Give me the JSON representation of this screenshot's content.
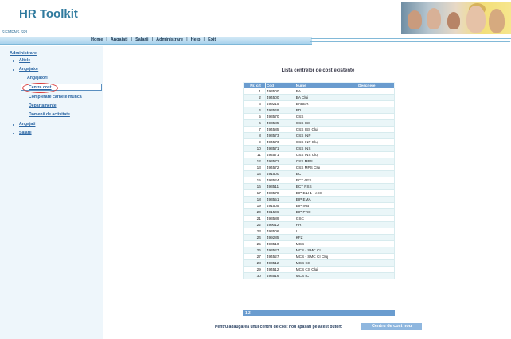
{
  "app": {
    "title": "HR Toolkit",
    "company": "SIEMENS SRL"
  },
  "menu": [
    "Home",
    "Angajati",
    "Salarii",
    "Administrare",
    "Help",
    "Exit"
  ],
  "sidebar": {
    "title": "Administrare",
    "items": [
      {
        "label": "Altele",
        "bullet": true
      },
      {
        "label": "Angajator",
        "bullet": true
      },
      {
        "label": "Angajatori",
        "bullet": false
      },
      {
        "label": "Centre cost",
        "bullet": false,
        "selected": true
      },
      {
        "label": "Completare carnete munca",
        "bullet": false
      },
      {
        "label": "Departamente",
        "bullet": false
      },
      {
        "label": "Domenii de activitate",
        "bullet": false
      },
      {
        "label": "Angajati",
        "bullet": true
      },
      {
        "label": "Salarii",
        "bullet": true
      }
    ]
  },
  "main": {
    "title": "Lista centrelor de cost existente",
    "columns": [
      "Nr. crt",
      "Cod",
      "Nume",
      "Descriere"
    ],
    "rows": [
      [
        "1",
        "493500",
        "BA",
        ""
      ],
      [
        "2",
        "494500",
        "BA Cluj",
        ""
      ],
      [
        "3",
        "499215",
        "BABER",
        ""
      ],
      [
        "4",
        "493549",
        "BD",
        ""
      ],
      [
        "5",
        "493570",
        "CSS",
        ""
      ],
      [
        "6",
        "493585",
        "CSS IBS",
        ""
      ],
      [
        "7",
        "494585",
        "CSS IBS Cluj",
        ""
      ],
      [
        "8",
        "493573",
        "CSS INP",
        ""
      ],
      [
        "9",
        "494573",
        "CSS INP Cluj",
        ""
      ],
      [
        "10",
        "493571",
        "CSS INS",
        ""
      ],
      [
        "11",
        "494571",
        "CSS INS Cluj",
        ""
      ],
      [
        "12",
        "493572",
        "CSS MPS",
        ""
      ],
      [
        "13",
        "494572",
        "CSS MPS Cluj",
        ""
      ],
      [
        "14",
        "491500",
        "ECT",
        ""
      ],
      [
        "15",
        "493524",
        "ECT AES",
        ""
      ],
      [
        "16",
        "493511",
        "ECT PSS",
        ""
      ],
      [
        "17",
        "493578",
        "EIP E&I 1 - eES",
        ""
      ],
      [
        "18",
        "493551",
        "EIP EMA",
        ""
      ],
      [
        "19",
        "491505",
        "EIP INB",
        ""
      ],
      [
        "20",
        "491506",
        "EIP PRO",
        ""
      ],
      [
        "21",
        "493589",
        "GSC",
        ""
      ],
      [
        "22",
        "499012",
        "HR",
        ""
      ],
      [
        "23",
        "493506",
        "I",
        ""
      ],
      [
        "24",
        "499285",
        "KFZ",
        ""
      ],
      [
        "25",
        "493510",
        "MCS",
        ""
      ],
      [
        "26",
        "493527",
        "MCS - SMC CI",
        ""
      ],
      [
        "27",
        "494527",
        "MCS - SMC CI Cluj",
        ""
      ],
      [
        "28",
        "493512",
        "MCS CS",
        ""
      ],
      [
        "29",
        "494512",
        "MCS CS Cluj",
        ""
      ],
      [
        "30",
        "493516",
        "MCS IC",
        ""
      ]
    ],
    "pages": "1 2",
    "add_note": "Pentru adaugarea unui centru de cost nou apasati pe acest buton:",
    "add_button": "Centru de cost nou"
  },
  "colors": {
    "accent": "#2f7a9e",
    "table_header": "#6a9ccf",
    "selected_marker": "#d73b3b"
  }
}
